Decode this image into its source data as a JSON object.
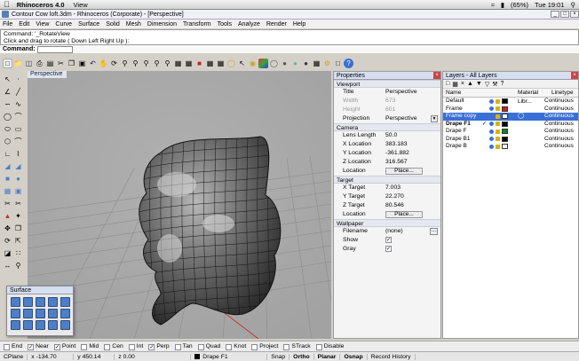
{
  "mac": {
    "app": "Rhinoceros 4.0",
    "view": "View",
    "battery": "(65%)",
    "clock": "Tue 19:01"
  },
  "window": {
    "title": "Contour Cow loft.3dm - Rhinoceros (Corporate) - [Perspective]"
  },
  "menu": [
    "File",
    "Edit",
    "View",
    "Curve",
    "Surface",
    "Solid",
    "Mesh",
    "Dimension",
    "Transform",
    "Tools",
    "Analyze",
    "Render",
    "Help"
  ],
  "command": {
    "history1": "Command: '_RotateView",
    "history2": "Click and drag to rotate ( Down  Left  Right  Up ):",
    "label": "Command:"
  },
  "viewport": {
    "label": "Perspective"
  },
  "surface_panel": {
    "title": "Surface"
  },
  "properties": {
    "title": "Properties",
    "viewport_section": "Viewport",
    "title_label": "Title",
    "title_value": "Perspective",
    "width_label": "Width",
    "width_value": "673",
    "height_label": "Height",
    "height_value": "601",
    "projection_label": "Projection",
    "projection_value": "Perspective",
    "camera_section": "Camera",
    "lens_label": "Lens Length",
    "lens_value": "50.0",
    "xloc_label": "X Location",
    "xloc_value": "383.183",
    "yloc_label": "Y Location",
    "yloc_value": "-361.882",
    "zloc_label": "Z Location",
    "zloc_value": "316.567",
    "location_label": "Location",
    "place_label": "Place...",
    "target_section": "Target",
    "xt_label": "X Target",
    "xt_value": "7.003",
    "yt_label": "Y Target",
    "yt_value": "22.270",
    "zt_label": "Z Target",
    "zt_value": "80.546",
    "tloc_label": "Location",
    "tplace_label": "Place...",
    "wallpaper_section": "Wallpaper",
    "filename_label": "Filename",
    "filename_value": "(none)",
    "browse_label": "...",
    "show_label": "Show",
    "gray_label": "Gray"
  },
  "layers": {
    "title": "Layers - All Layers",
    "col_name": "Name",
    "col_material": "Material Libr...",
    "col_linetype": "Linetype",
    "rows": [
      {
        "name": "Default",
        "linetype": "Continuous",
        "color": "#000000",
        "sel": false
      },
      {
        "name": "Frame",
        "linetype": "Continuous",
        "color": "#d81c1c",
        "sel": false
      },
      {
        "name": "Frame copy",
        "linetype": "Continuous",
        "color": "#ffffff",
        "sel": true
      },
      {
        "name": "Drape F1",
        "linetype": "Continuous",
        "color": "#000000",
        "sel": false,
        "bold": true
      },
      {
        "name": "Drape F",
        "linetype": "Continuous",
        "color": "#0a8a1e",
        "sel": false
      },
      {
        "name": "Drape B1",
        "linetype": "Continuous",
        "color": "#000000",
        "sel": false
      },
      {
        "name": "Drape B",
        "linetype": "Continuous",
        "color": "#ffffff",
        "sel": false
      }
    ]
  },
  "osnap": [
    {
      "label": "End",
      "on": false
    },
    {
      "label": "Near",
      "on": true
    },
    {
      "label": "Point",
      "on": true
    },
    {
      "label": "Mid",
      "on": false
    },
    {
      "label": "Cen",
      "on": false
    },
    {
      "label": "Int",
      "on": false
    },
    {
      "label": "Perp",
      "on": true
    },
    {
      "label": "Tan",
      "on": false
    },
    {
      "label": "Quad",
      "on": false
    },
    {
      "label": "Knot",
      "on": false
    },
    {
      "label": "Project",
      "on": false
    },
    {
      "label": "STrack",
      "on": false
    },
    {
      "label": "Disable",
      "on": false
    }
  ],
  "status": {
    "cplane": "CPlane",
    "x": "x -134.70",
    "y": "y 450.14",
    "z": "z 0.00",
    "layer": "Drape F1",
    "snap": "Snap",
    "ortho": "Ortho",
    "planar": "Planar",
    "osnap": "Osnap",
    "record": "Record History"
  }
}
